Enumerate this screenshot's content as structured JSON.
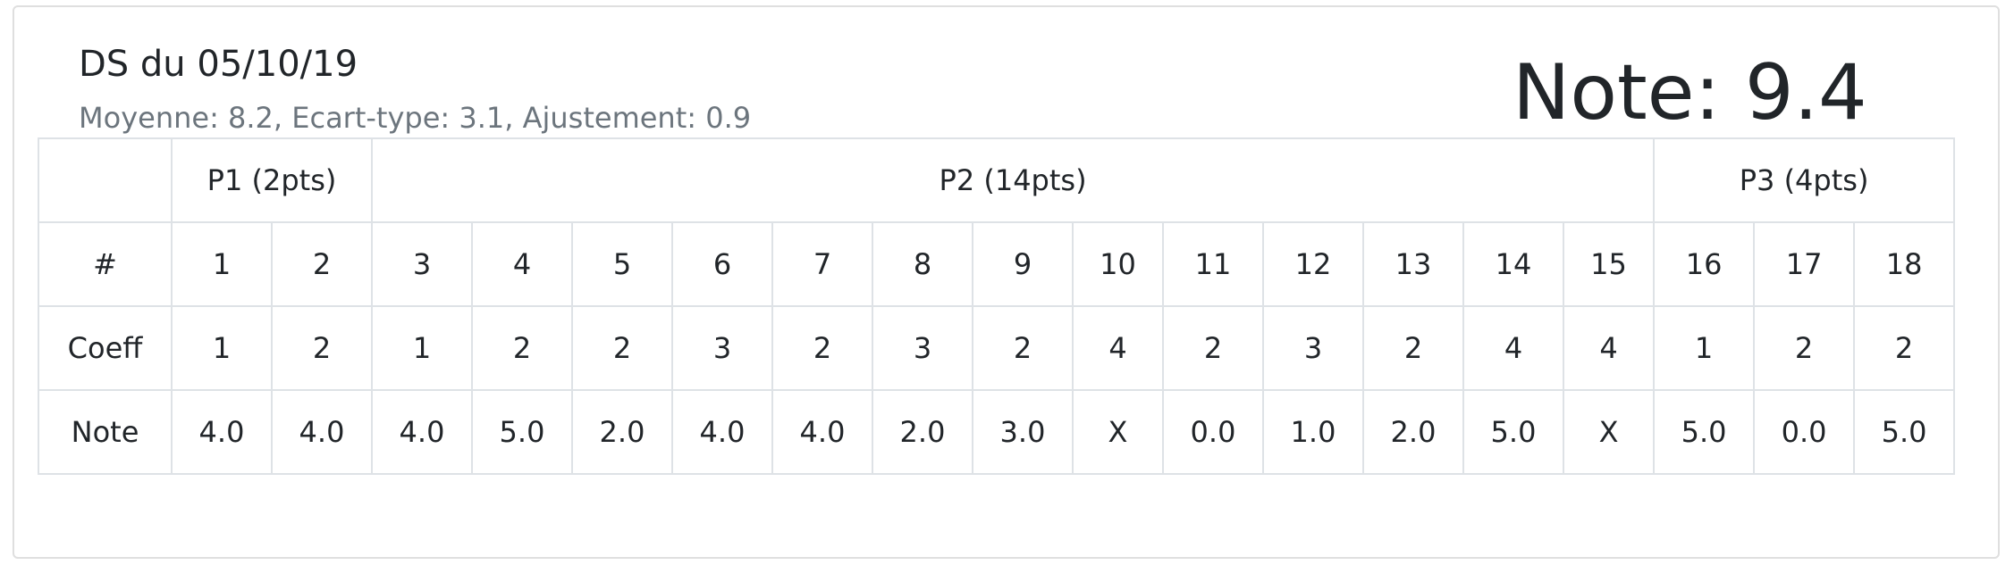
{
  "header": {
    "title": "DS du 05/10/19",
    "subtitle": "Moyenne: 8.2, Ecart-type: 3.1, Ajustement: 0.9",
    "note": "Note: 9.4"
  },
  "table": {
    "groups": [
      {
        "label": "P1 (2pts)",
        "span": 2
      },
      {
        "label": "P2 (14pts)",
        "span": 13
      },
      {
        "label": "P3 (4pts)",
        "span": 3
      }
    ],
    "row_labels": {
      "number": "#",
      "coeff": "Coeff",
      "note": "Note"
    },
    "questions": [
      {
        "num": "1",
        "coeff": "1",
        "note": "4.0"
      },
      {
        "num": "2",
        "coeff": "2",
        "note": "4.0"
      },
      {
        "num": "3",
        "coeff": "1",
        "note": "4.0"
      },
      {
        "num": "4",
        "coeff": "2",
        "note": "5.0"
      },
      {
        "num": "5",
        "coeff": "2",
        "note": "2.0"
      },
      {
        "num": "6",
        "coeff": "3",
        "note": "4.0"
      },
      {
        "num": "7",
        "coeff": "2",
        "note": "4.0"
      },
      {
        "num": "8",
        "coeff": "3",
        "note": "2.0"
      },
      {
        "num": "9",
        "coeff": "2",
        "note": "3.0"
      },
      {
        "num": "10",
        "coeff": "4",
        "note": "X"
      },
      {
        "num": "11",
        "coeff": "2",
        "note": "0.0"
      },
      {
        "num": "12",
        "coeff": "3",
        "note": "1.0"
      },
      {
        "num": "13",
        "coeff": "2",
        "note": "2.0"
      },
      {
        "num": "14",
        "coeff": "4",
        "note": "5.0"
      },
      {
        "num": "15",
        "coeff": "4",
        "note": "X"
      },
      {
        "num": "16",
        "coeff": "1",
        "note": "5.0"
      },
      {
        "num": "17",
        "coeff": "2",
        "note": "0.0"
      },
      {
        "num": "18",
        "coeff": "2",
        "note": "5.0"
      }
    ]
  }
}
